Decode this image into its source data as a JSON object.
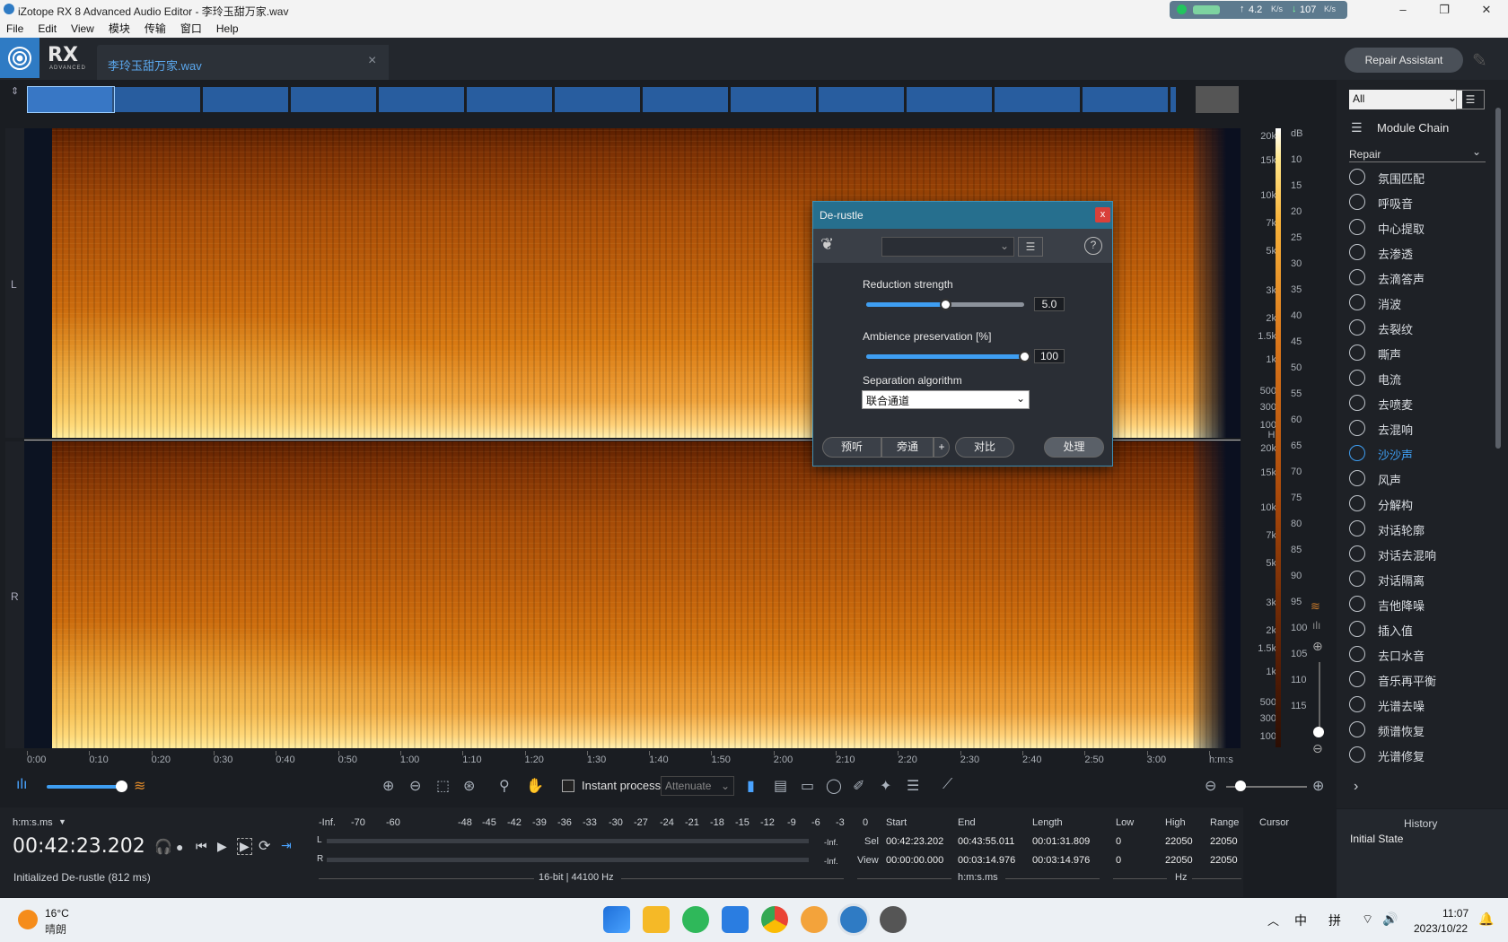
{
  "window": {
    "title": "iZotope RX 8 Advanced Audio Editor - 李玲玉甜万家.wav",
    "net_up": "4.2",
    "net_down": "107",
    "net_unit": "K/s"
  },
  "menu": [
    "File",
    "Edit",
    "View",
    "模块",
    "传输",
    "窗口",
    "Help"
  ],
  "app": {
    "logo": "RX",
    "logo_sub": "ADVANCED",
    "file_tab": "李玲玉甜万家.wav",
    "repair_assistant": "Repair Assistant"
  },
  "channels": {
    "left": "L",
    "right": "R"
  },
  "hz_axis": [
    "20k",
    "15k",
    "10k",
    "7k",
    "5k",
    "3k",
    "2k",
    "1.5k",
    "1k",
    "500",
    "300",
    "100",
    "Hz"
  ],
  "db_axis": [
    "dB",
    "10",
    "15",
    "20",
    "25",
    "30",
    "35",
    "40",
    "45",
    "50",
    "55",
    "60",
    "65",
    "70",
    "75",
    "80",
    "85",
    "90",
    "95",
    "100",
    "105",
    "110",
    "115"
  ],
  "time_ruler": [
    "0:00",
    "0:10",
    "0:20",
    "0:30",
    "0:40",
    "0:50",
    "1:00",
    "1:10",
    "1:20",
    "1:30",
    "1:40",
    "1:50",
    "2:00",
    "2:10",
    "2:20",
    "2:30",
    "2:40",
    "2:50",
    "3:00",
    "h:m:s"
  ],
  "toolbar": {
    "instant_process": "Instant process",
    "mode": "Attenuate"
  },
  "transport": {
    "format": "h:m:s.ms",
    "timecode": "00:42:23.202",
    "status": "Initialized De-rustle (812 ms)"
  },
  "meter": {
    "scale": [
      "-Inf.",
      "-70",
      "-60",
      "-48",
      "-45",
      "-42",
      "-39",
      "-36",
      "-33",
      "-30",
      "-27",
      "-24",
      "-21",
      "-18",
      "-15",
      "-12",
      "-9",
      "-6",
      "-3",
      "0"
    ],
    "l": "L",
    "r": "R",
    "l_peak": "-Inf.",
    "r_peak": "-Inf.",
    "format": "16-bit | 44100 Hz"
  },
  "selection": {
    "start_h": "Start",
    "end_h": "End",
    "length_h": "Length",
    "sel": "Sel",
    "view": "View",
    "sel_start": "00:42:23.202",
    "sel_end": "00:43:55.011",
    "sel_len": "00:01:31.809",
    "view_start": "00:00:00.000",
    "view_end": "00:03:14.976",
    "view_len": "00:03:14.976",
    "unit": "h:m:s.ms"
  },
  "freq": {
    "low_h": "Low",
    "high_h": "High",
    "range_h": "Range",
    "cursor_h": "Cursor",
    "sel_low": "0",
    "sel_high": "22050",
    "sel_range": "22050",
    "view_low": "0",
    "view_high": "22050",
    "view_range": "22050",
    "unit": "Hz"
  },
  "right_panel": {
    "filter": "All",
    "module_chain": "Module Chain",
    "category": "Repair",
    "modules": [
      "氛围匹配",
      "呼吸音",
      "中心提取",
      "去渗透",
      "去滴答声",
      "消波",
      "去裂纹",
      "嘶声",
      "电流",
      "去喷麦",
      "去混响",
      "沙沙声",
      "风声",
      "分解构",
      "对话轮廓",
      "对话去混响",
      "对话隔离",
      "吉他降噪",
      "插入值",
      "去口水音",
      "音乐再平衡",
      "光谱去噪",
      "频谱恢复",
      "光谱修复"
    ],
    "active_module": "沙沙声",
    "history_title": "History",
    "history_item": "Initial State"
  },
  "dialog": {
    "title": "De-rustle",
    "close": "x",
    "reduction_label": "Reduction strength",
    "reduction_value": "5.0",
    "reduction_fraction": 0.5,
    "ambience_label": "Ambience preservation [%]",
    "ambience_value": "100",
    "ambience_fraction": 1.0,
    "algorithm_label": "Separation algorithm",
    "algorithm_value": "联合通道",
    "preview": "预听",
    "bypass": "旁通",
    "plus": "+",
    "compare": "对比",
    "process": "处理"
  },
  "taskbar": {
    "temp": "16°C",
    "weather": "晴朗",
    "ime1": "中",
    "ime2": "拼",
    "time": "11:07",
    "date": "2023/10/22"
  },
  "colors": {
    "accent": "#3e9ef2",
    "dialog_header": "#266f8e",
    "logo": "#2f7bc4"
  }
}
